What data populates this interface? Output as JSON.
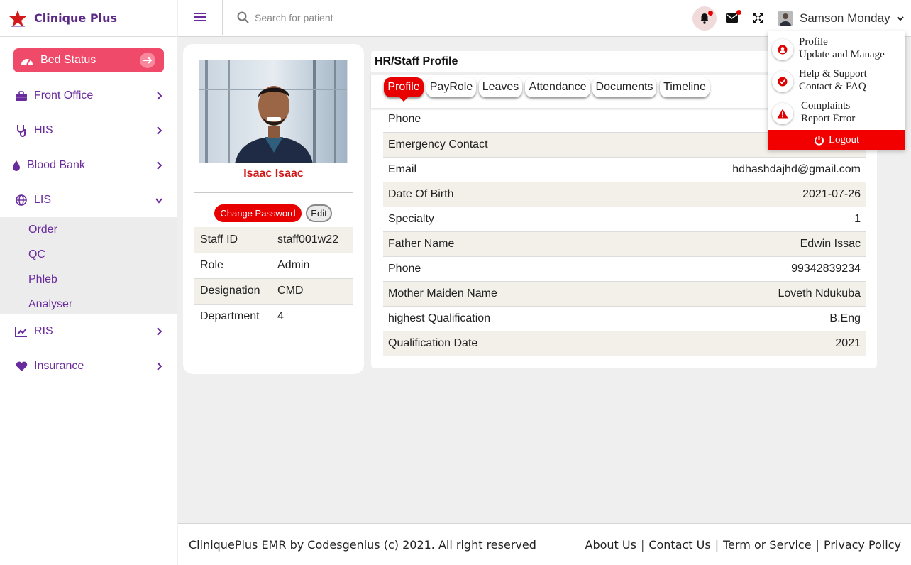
{
  "brand": {
    "name": "Clinique Plus",
    "accent": "#5b2a86",
    "star_color": "#d21a1a"
  },
  "sidebar": {
    "bed_status": "Bed Status",
    "items": [
      {
        "label": "Front Office",
        "icon": "briefcase-icon"
      },
      {
        "label": "HIS",
        "icon": "stethoscope-icon"
      },
      {
        "label": "Blood Bank",
        "icon": "droplet-icon"
      },
      {
        "label": "LIS",
        "icon": "globe-icon"
      },
      {
        "label": "RIS",
        "icon": "chart-line-icon"
      },
      {
        "label": "Insurance",
        "icon": "heart-icon"
      }
    ],
    "lis_sub": [
      "Order",
      "QC",
      "Phleb",
      "Analyser"
    ]
  },
  "header": {
    "search_placeholder": "Search for patient",
    "user_name": "Samson Monday"
  },
  "user_menu": [
    {
      "line1": "Profile",
      "line2": "Update and Manage",
      "icon": "user-circle-icon"
    },
    {
      "line1": "Help & Support",
      "line2": "Contact & FAQ",
      "icon": "check-circle-icon"
    },
    {
      "line1": "Complaints",
      "line2": "Report Error",
      "icon": "warning-icon"
    }
  ],
  "logout_label": "Logout",
  "staff": {
    "name": "Isaac Isaac",
    "change_password": "Change Password",
    "edit": "Edit",
    "fields": [
      {
        "label": "Staff ID",
        "value": "staff001w22"
      },
      {
        "label": "Role",
        "value": "Admin"
      },
      {
        "label": "Designation",
        "value": "CMD"
      },
      {
        "label": "Department",
        "value": "4"
      }
    ]
  },
  "profile": {
    "title": "HR/Staff Profile",
    "tabs": [
      "Profile",
      "PayRole",
      "Leaves",
      "Attendance",
      "Documents",
      "Timeline"
    ],
    "active_tab": "Profile",
    "rows": [
      {
        "label": "Phone",
        "value": ""
      },
      {
        "label": "Emergency Contact",
        "value": ""
      },
      {
        "label": "Email",
        "value": "hdhashdajhd@gmail.com"
      },
      {
        "label": "Date Of Birth",
        "value": "2021-07-26"
      },
      {
        "label": "Specialty",
        "value": "1"
      },
      {
        "label": "Father Name",
        "value": "Edwin Issac"
      },
      {
        "label": "Phone",
        "value": "99342839234"
      },
      {
        "label": "Mother Maiden Name",
        "value": "Loveth Ndukuba"
      },
      {
        "label": "highest Qualification",
        "value": "B.Eng"
      },
      {
        "label": "Qualification Date",
        "value": "2021"
      }
    ]
  },
  "footer": {
    "copyright": "CliniquePlus EMR by Codesgenius (c) 2021. All right reserved",
    "links": [
      "About Us",
      "Contact Us",
      "Term or Service",
      "Privacy Policy"
    ]
  },
  "colors": {
    "primary_red": "#e80000",
    "bed_status": "#ef4a6a",
    "nav_purple": "#6a2c9c"
  }
}
